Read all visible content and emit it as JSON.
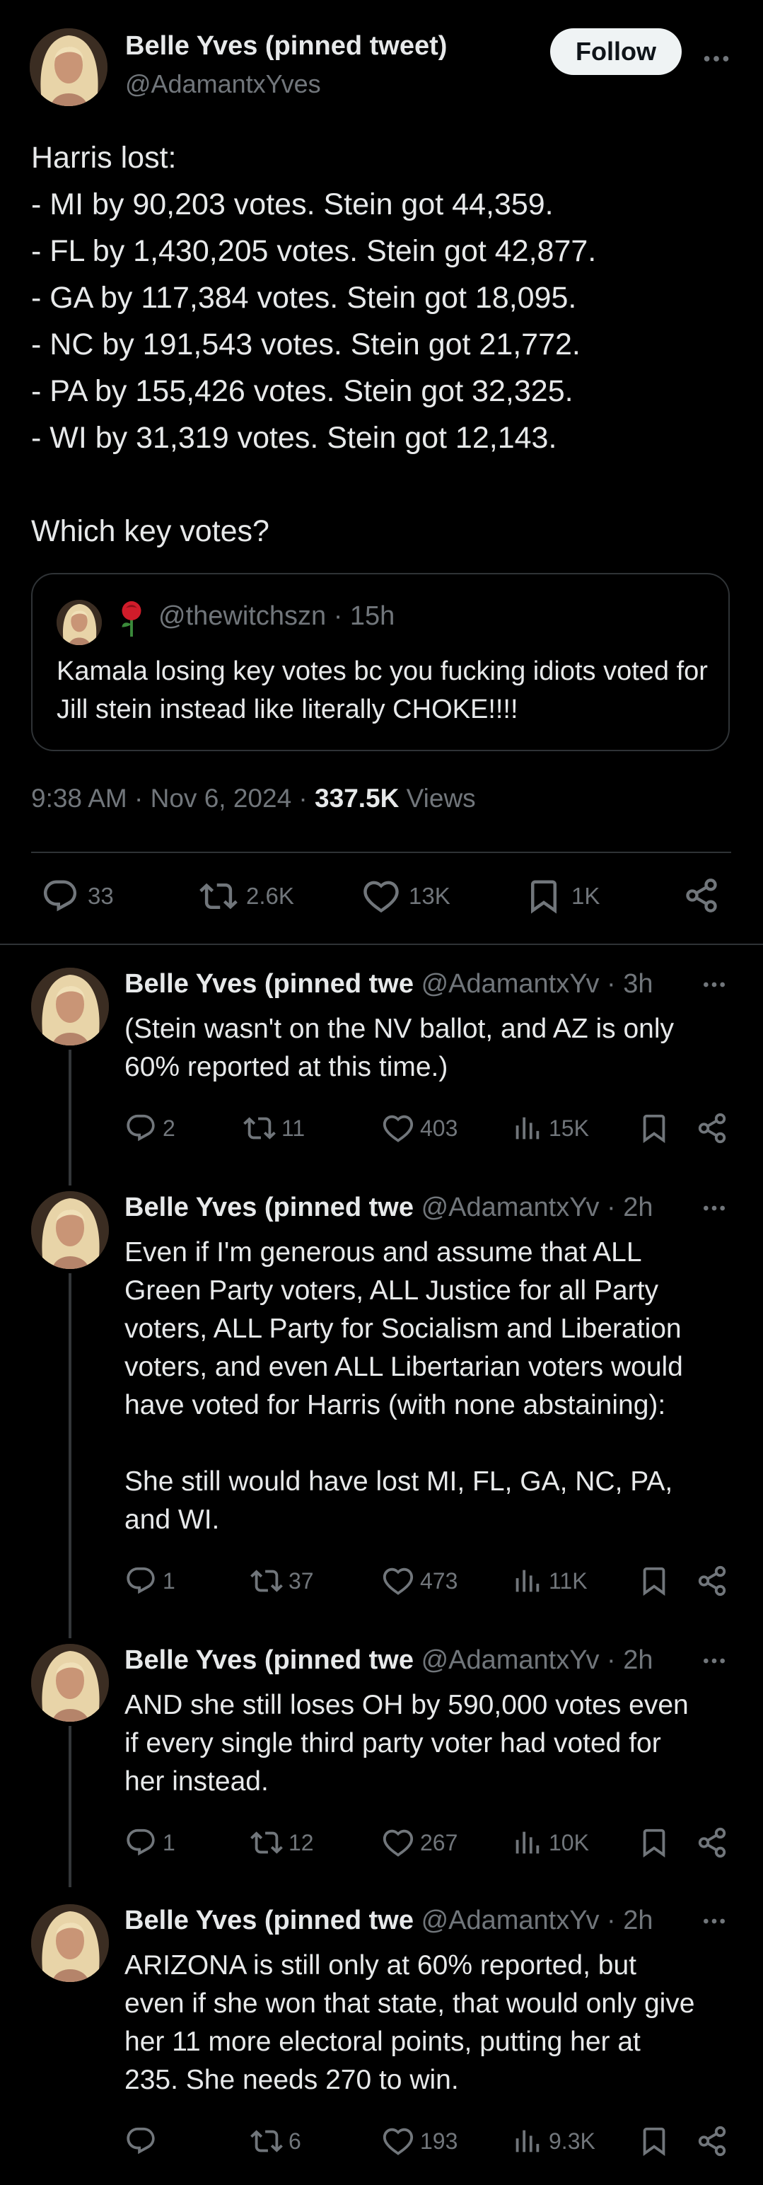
{
  "main_tweet": {
    "author_name": "Belle Yves (pinned tweet)",
    "author_handle": "@AdamantxYves",
    "follow_label": "Follow",
    "text": "Harris lost:\n- MI by 90,203 votes. Stein got 44,359.\n- FL by 1,430,205 votes. Stein got 42,877.\n- GA by 117,384 votes. Stein got 18,095.\n- NC by 191,543 votes. Stein got 21,772.\n- PA by 155,426 votes. Stein got 32,325.\n- WI by 31,319 votes. Stein got 12,143.\n\nWhich key votes?",
    "quote": {
      "handle": "@thewitchszn",
      "time": "· 15h",
      "text": "Kamala losing key votes bc you fucking idiots voted for Jill stein instead like literally CHOKE!!!!"
    },
    "timestamp": "9:38 AM · Nov 6, 2024 · ",
    "views_count": "337.5K",
    "views_label": " Views",
    "actions": {
      "replies": "33",
      "retweets": "2.6K",
      "likes": "13K",
      "bookmarks": "1K"
    }
  },
  "replies": [
    {
      "name": "Belle Yves (pinned twe",
      "handle_time": " @AdamantxYv · 3h",
      "text": "(Stein wasn't on the NV ballot, and AZ is only\n60% reported at this time.)",
      "replies": "2",
      "retweets": "11",
      "likes": "403",
      "views": "15K"
    },
    {
      "name": "Belle Yves (pinned twe",
      "handle_time": " @AdamantxYv · 2h",
      "text": "Even if I'm generous and assume that ALL\nGreen Party voters, ALL Justice for all Party\nvoters, ALL Party for Socialism and Liberation\nvoters, and even ALL Libertarian voters would\nhave voted for Harris (with none abstaining):\n\nShe still would have lost MI, FL, GA, NC, PA,\nand WI.",
      "replies": "1",
      "retweets": "37",
      "likes": "473",
      "views": "11K"
    },
    {
      "name": "Belle Yves (pinned twe",
      "handle_time": " @AdamantxYv · 2h",
      "text": "AND she still loses OH by 590,000 votes even\nif every single third party voter had voted for\nher instead.",
      "replies": "1",
      "retweets": "12",
      "likes": "267",
      "views": "10K"
    },
    {
      "name": "Belle Yves (pinned twe",
      "handle_time": " @AdamantxYv · 2h",
      "text": "ARIZONA is still only at 60% reported, but\neven if she won that state, that would only give\nher 11 more electoral points, putting her at\n235. She needs 270 to win.",
      "replies": "",
      "retweets": "6",
      "likes": "193",
      "views": "9.3K"
    }
  ]
}
